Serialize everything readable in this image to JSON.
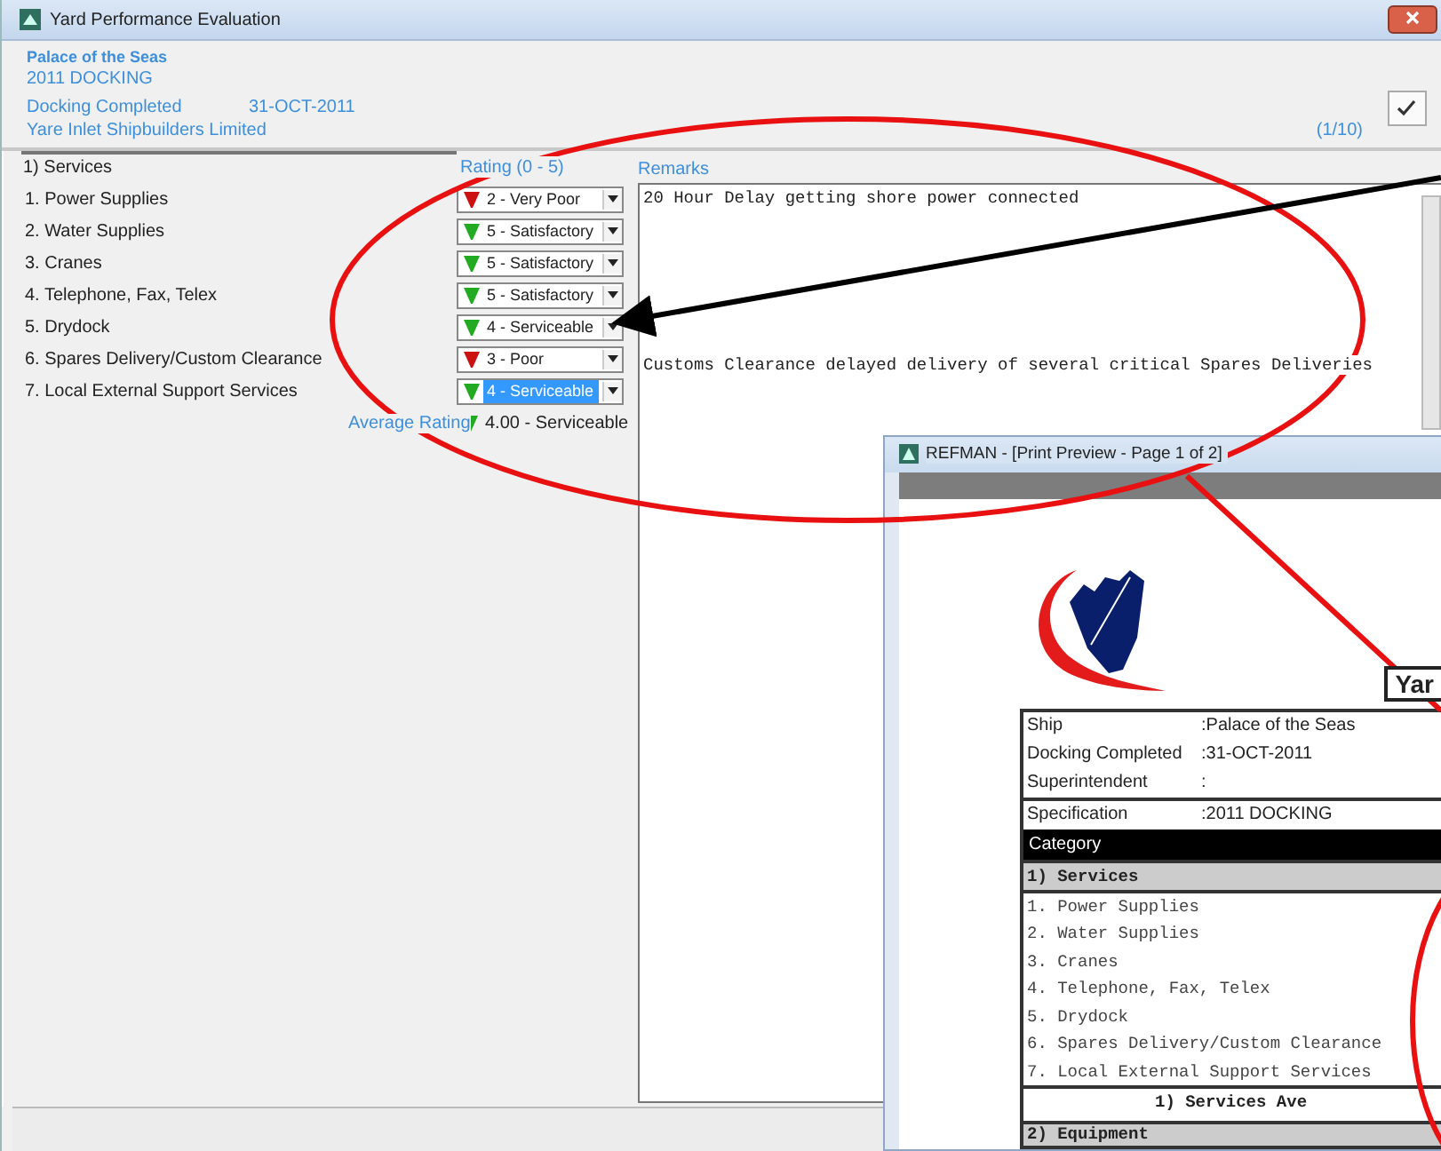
{
  "window": {
    "title": "Yard Performance Evaluation"
  },
  "header": {
    "group_label": "Palace of the Seas",
    "specification": "2011 DOCKING",
    "docking_label": "Docking Completed",
    "docking_date": "31-OCT-2011",
    "yard": "Yare Inlet Shipbuilders Limited",
    "page_counter": "(1/10)"
  },
  "category": "1) Services",
  "rating_header": "Rating (0 - 5)",
  "remarks_header": "Remarks",
  "items": [
    {
      "label": "1. Power Supplies",
      "rating": "2 - Very Poor",
      "color": "#cc1111",
      "selected": false,
      "remark": "20 Hour Delay getting shore power connected"
    },
    {
      "label": "2. Water Supplies",
      "rating": "5 - Satisfactory",
      "color": "#22aa22",
      "selected": false
    },
    {
      "label": "3. Cranes",
      "rating": "5 - Satisfactory",
      "color": "#22aa22",
      "selected": false
    },
    {
      "label": "4. Telephone, Fax, Telex",
      "rating": "5 - Satisfactory",
      "color": "#22aa22",
      "selected": false
    },
    {
      "label": "5. Drydock",
      "rating": "4 - Serviceable",
      "color": "#22aa22",
      "selected": false
    },
    {
      "label": "6. Spares Delivery/Custom Clearance",
      "rating": "3 - Poor",
      "color": "#cc1111",
      "selected": false,
      "remark": "Customs Clearance delayed delivery of several critical Spares Deliveries"
    },
    {
      "label": "7. Local External Support Services",
      "rating": "4 - Serviceable",
      "color": "#22aa22",
      "selected": true
    }
  ],
  "average": {
    "label": "Average Rating",
    "color": "#22aa22",
    "value": "4.00 - Serviceable"
  },
  "preview": {
    "title": "REFMAN - [Print Preview - Page 1 of 2]",
    "heading": "Yar",
    "info": [
      {
        "label": "Ship",
        "value": ":Palace of the Seas"
      },
      {
        "label": "Docking Completed",
        "value": ":31-OCT-2011"
      },
      {
        "label": "Superintendent",
        "value": ":"
      }
    ],
    "specification": {
      "label": "Specification",
      "value": ":2011 DOCKING"
    },
    "category_header": "Category",
    "section": "1) Services",
    "items": [
      "1. Power Supplies",
      "2. Water Supplies",
      "3. Cranes",
      "4. Telephone, Fax, Telex",
      "5. Drydock",
      "6. Spares Delivery/Custom Clearance",
      "7. Local External Support Services"
    ],
    "section_footer": "1) Services Ave",
    "next_section": "2) Equipment"
  }
}
